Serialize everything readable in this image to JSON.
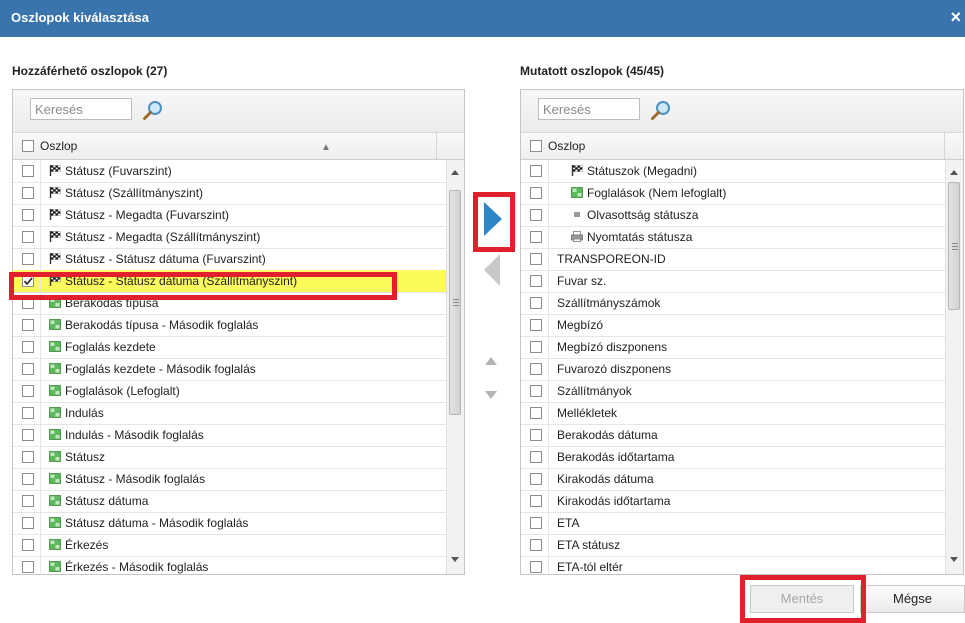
{
  "dialog": {
    "title": "Oszlopok kiválasztása",
    "close_icon": "×"
  },
  "available": {
    "heading": "Hozzáférhető oszlopok (27)",
    "search_placeholder": "Keresés",
    "column_header": "Oszlop",
    "rows": [
      {
        "label": "Státusz (Fuvarszint)",
        "icon": "checkered-flag-icon",
        "checked": false
      },
      {
        "label": "Státusz (Szállítmányszint)",
        "icon": "checkered-flag-icon",
        "checked": false
      },
      {
        "label": "Státusz - Megadta (Fuvarszint)",
        "icon": "checkered-flag-icon",
        "checked": false
      },
      {
        "label": "Státusz - Megadta (Szállítmányszint)",
        "icon": "checkered-flag-icon",
        "checked": false
      },
      {
        "label": "Státusz - Státusz dátuma (Fuvarszint)",
        "icon": "checkered-flag-icon",
        "checked": false
      },
      {
        "label": "Státusz - Státusz dátuma (Szállítmányszint)",
        "icon": "checkered-flag-icon",
        "checked": true
      },
      {
        "label": "Berakodás típusa",
        "icon": "slot-icon",
        "checked": false
      },
      {
        "label": "Berakodás típusa - Második foglalás",
        "icon": "slot-icon",
        "checked": false
      },
      {
        "label": "Foglalás kezdete",
        "icon": "slot-icon",
        "checked": false
      },
      {
        "label": "Foglalás kezdete - Második foglalás",
        "icon": "slot-icon",
        "checked": false
      },
      {
        "label": "Foglalások (Lefoglalt)",
        "icon": "slot-icon",
        "checked": false
      },
      {
        "label": "Indulás",
        "icon": "slot-icon",
        "checked": false
      },
      {
        "label": "Indulás - Második foglalás",
        "icon": "slot-icon",
        "checked": false
      },
      {
        "label": "Státusz",
        "icon": "slot-icon",
        "checked": false
      },
      {
        "label": "Státusz - Második foglalás",
        "icon": "slot-icon",
        "checked": false
      },
      {
        "label": "Státusz dátuma",
        "icon": "slot-icon",
        "checked": false
      },
      {
        "label": "Státusz dátuma - Második foglalás",
        "icon": "slot-icon",
        "checked": false
      },
      {
        "label": "Érkezés",
        "icon": "slot-icon",
        "checked": false
      },
      {
        "label": "Érkezés - Második foglalás",
        "icon": "slot-icon",
        "checked": false
      }
    ]
  },
  "shown": {
    "heading": "Mutatott oszlopok (45/45)",
    "search_placeholder": "Keresés",
    "column_header": "Oszlop",
    "rows": [
      {
        "label": "Státuszok (Megadni)",
        "icon": "checkered-flag-icon"
      },
      {
        "label": "Foglalások (Nem lefoglalt)",
        "icon": "slot-icon"
      },
      {
        "label": "Olvasottság státusza",
        "icon": "square-icon"
      },
      {
        "label": "Nyomtatás státusza",
        "icon": "printer-icon"
      },
      {
        "label": "TRANSPOREON-ID",
        "icon": ""
      },
      {
        "label": "Fuvar sz.",
        "icon": ""
      },
      {
        "label": "Szállítmányszámok",
        "icon": ""
      },
      {
        "label": "Megbízó",
        "icon": ""
      },
      {
        "label": "Megbízó diszponens",
        "icon": ""
      },
      {
        "label": "Fuvarozó diszponens",
        "icon": ""
      },
      {
        "label": "Szállítmányok",
        "icon": ""
      },
      {
        "label": "Mellékletek",
        "icon": ""
      },
      {
        "label": "Berakodás dátuma",
        "icon": ""
      },
      {
        "label": "Berakodás időtartama",
        "icon": ""
      },
      {
        "label": "Kirakodás dátuma",
        "icon": ""
      },
      {
        "label": "Kirakodás időtartama",
        "icon": ""
      },
      {
        "label": "ETA",
        "icon": ""
      },
      {
        "label": "ETA státusz",
        "icon": ""
      },
      {
        "label": "ETA-tól eltér",
        "icon": ""
      }
    ]
  },
  "buttons": {
    "save": "Mentés",
    "cancel": "Mégse"
  },
  "colors": {
    "title_bar": "#3a74ad",
    "highlight_box": "#e0202c",
    "selected_row": "#fafa5a",
    "move_arrow": "#2f86c6"
  }
}
